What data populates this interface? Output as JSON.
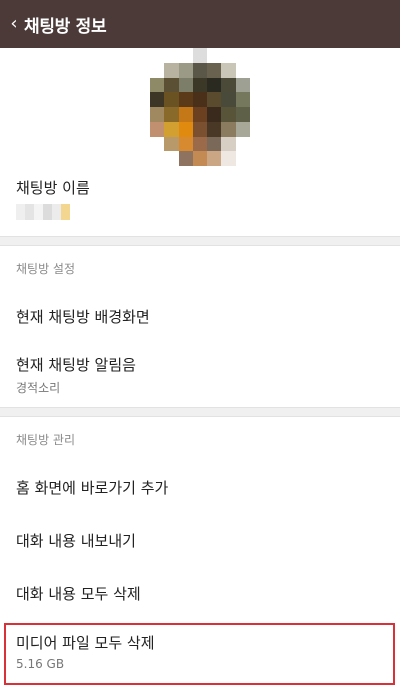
{
  "header": {
    "back_glyph": "‹",
    "title": "채팅방 정보",
    "bar_color": "#4b3a38"
  },
  "profile": {
    "avatar": "pixelated-profile-image"
  },
  "name_section": {
    "label": "채팅방 이름"
  },
  "settings_section": {
    "header": "채팅방 설정",
    "items": [
      {
        "label": "현재 채팅방 배경화면"
      },
      {
        "label": "현재 채팅방 알림음",
        "sub": "경적소리"
      }
    ]
  },
  "manage_section": {
    "header": "채팅방 관리",
    "items": [
      {
        "label": "홈 화면에 바로가기 추가"
      },
      {
        "label": "대화 내용 내보내기"
      },
      {
        "label": "대화 내용 모두 삭제"
      },
      {
        "label": "미디어 파일 모두 삭제",
        "sub": "5.16 GB"
      }
    ]
  },
  "highlight_color": "#d8313a"
}
